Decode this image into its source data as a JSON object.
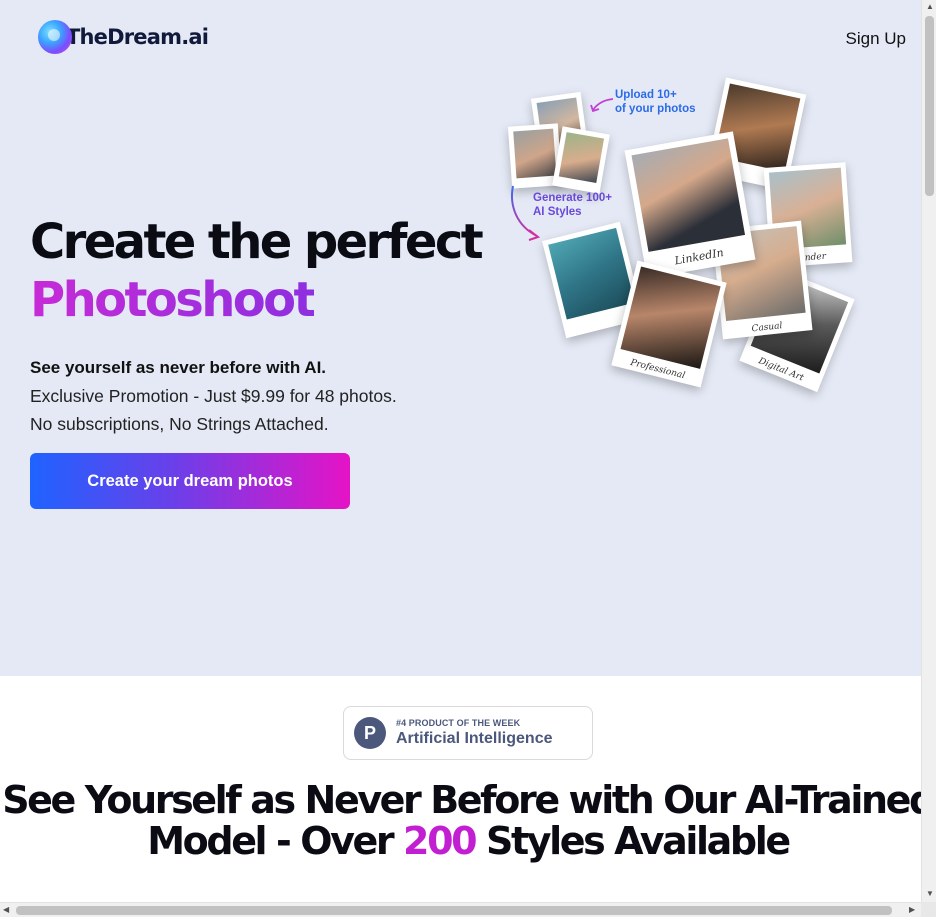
{
  "header": {
    "logo_text": "TheDream.ai",
    "signup_label": "Sign Up"
  },
  "hero": {
    "title_line1": "Create the perfect",
    "title_line2": "Photoshoot",
    "lead": "See yourself as never before with AI.",
    "promo": "Exclusive Promotion - Just $9.99 for 48 photos.",
    "no_strings": "No subscriptions, No Strings Attached.",
    "cta_label": "Create your dream photos"
  },
  "collage": {
    "upload_line1": "Upload 10+",
    "upload_line2": "of your photos",
    "generate_line1": "Generate 100+",
    "generate_line2": "AI Styles",
    "captions": {
      "linkedin": "LinkedIn",
      "tinder": "Tinder",
      "casual": "Casual",
      "professional": "Professional",
      "digital_art": "Digital Art"
    }
  },
  "product_hunt": {
    "icon_letter": "P",
    "rank": "#4 PRODUCT OF THE WEEK",
    "category": "Artificial Intelligence"
  },
  "section": {
    "heading_line1": "See Yourself as Never Before with Our AI-Trained",
    "heading_line2_pre": "Model - Over ",
    "heading_number": "200",
    "heading_line2_post": " Styles Available"
  },
  "colors": {
    "hero_bg": "#e4e9f5",
    "accent_purple": "#c21fd3",
    "cta_start": "#1f63ff",
    "cta_end": "#e613c6",
    "ph_blue": "#4b587c"
  }
}
